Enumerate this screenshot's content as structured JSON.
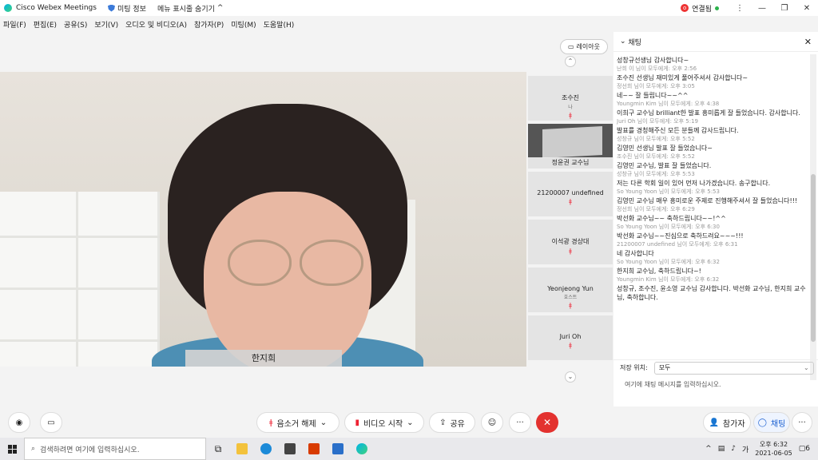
{
  "titlebar": {
    "app_title": "Cisco Webex Meetings",
    "meeting_info": "미팅 정보",
    "hide_menu": "메뉴 표시줄 숨기기",
    "connection": "연결됨"
  },
  "menu": [
    "파일(F)",
    "편집(E)",
    "공유(S)",
    "보기(V)",
    "오디오 및 비디오(A)",
    "참가자(P)",
    "미팅(M)",
    "도움말(H)"
  ],
  "video": {
    "speaker_name": "한지희"
  },
  "layout_button": "레이아웃",
  "participants": [
    {
      "name": "조수진",
      "sub": "나"
    },
    {
      "name": "정윤권 교수님",
      "sub": ""
    },
    {
      "name": "21200007 undefined",
      "sub": ""
    },
    {
      "name": "이석광 경상대",
      "sub": ""
    },
    {
      "name": "Yeonjeong Yun",
      "sub": "호스트"
    },
    {
      "name": "Juri Oh",
      "sub": ""
    }
  ],
  "chat": {
    "title": "채팅",
    "messages": [
      {
        "meta": "",
        "text": "성창규선생님 감사합니다~"
      },
      {
        "meta": "난희 이 님이 모두에게:     오후 2:56",
        "text": "조수진 선생님 재미있게 풀어주셔서 감사합니다~"
      },
      {
        "meta": "정선희 님이 모두에게:     오후 3:05",
        "text": "네~~ 잘 들립니다~~^^"
      },
      {
        "meta": "Youngmin Kim 님이 모두에게:     오후 4:38",
        "text": "이희구 교수님 brilliant한 발표 흥미롭게 잘 들었습니다. 감사합니다."
      },
      {
        "meta": "Juri Oh 님이 모두에게:     오후 5:19",
        "text": "발표를 경청해주신 모든 분들께 감사드립니다."
      },
      {
        "meta": "성창규 님이 모두에게:     오후 5:52",
        "text": "김영민 선생님 발표 잘 들었습니다~"
      },
      {
        "meta": "조수진 님이 모두에게:     오후 5:52",
        "text": "김영민 교수님, 발표 잘 들었습니다."
      },
      {
        "meta": "성창규 님이 모두에게:     오후 5:53",
        "text": "저는 다른 학회 일이 있어 먼저 나가겠습니다. 송구합니다."
      },
      {
        "meta": "So Young Yoon 님이 모두에게:     오후 5:53",
        "text": "김영민 교수님 매우 흥미로운 주제로 진행해주셔서 잘 들었습니다!!!"
      },
      {
        "meta": "정선희 님이 모두에게:     오후 6:29",
        "text": "박선화 교수님~~ 축하드립니다~~!^^"
      },
      {
        "meta": "So Young Yoon 님이 모두에게:     오후 6:30",
        "text": "박선화 교수님~~진심으로 축하드려요~~~!!!"
      },
      {
        "meta": "21200007 undefined 님이 모두에게:     오후 6:31",
        "text": "네 감사합니다"
      },
      {
        "meta": "So Young Yoon 님이 모두에게:     오후 6:32",
        "text": "한지희 교수님, 축하드립니다~!"
      },
      {
        "meta": "Youngmin Kim 님이 모두에게:     오후 6:32",
        "text": "성창규, 조수진, 윤소영 교수님 감사합니다. 박선화 교수님, 한지희 교수님, 축하합니다."
      }
    ],
    "save_label": "저장 위치:",
    "save_value": "모두",
    "input_placeholder": "여기에 채팅 메시지를 입력하십시오."
  },
  "controls": {
    "mute": "음소거 해제",
    "video": "비디오 시작",
    "share": "공유",
    "participants": "참가자",
    "chat": "채팅"
  },
  "taskbar": {
    "search_placeholder": "검색하려면 여기에 입력하십시오.",
    "ime": "가",
    "time": "오후 6:32",
    "date": "2021-06-05",
    "notif": "6"
  },
  "colors": {
    "accent": "#1a5fd0",
    "danger": "#e3322f",
    "connected": "#2bb24c"
  }
}
